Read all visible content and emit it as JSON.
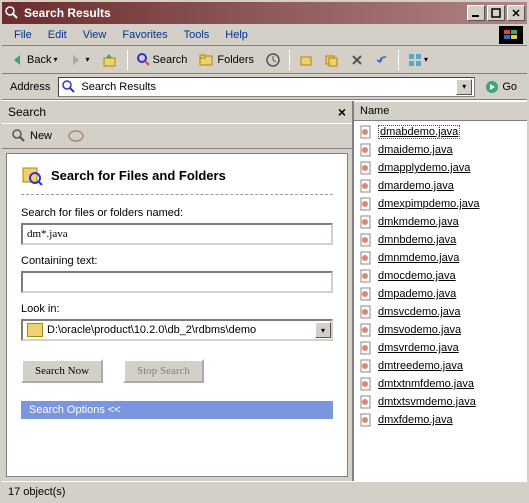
{
  "titlebar": {
    "title": "Search Results"
  },
  "menu": {
    "items": [
      "File",
      "Edit",
      "View",
      "Favorites",
      "Tools",
      "Help"
    ]
  },
  "toolbar": {
    "back": "Back",
    "search": "Search",
    "folders": "Folders"
  },
  "addressbar": {
    "label": "Address",
    "value": "Search Results",
    "go": "Go"
  },
  "searchpane": {
    "title": "Search",
    "new": "New",
    "heading": "Search for Files and Folders",
    "named_label": "Search for files or folders named:",
    "named_value": "dm*.java",
    "containing_label": "Containing text:",
    "containing_value": "",
    "lookin_label": "Look in:",
    "lookin_value": "D:\\oracle\\product\\10.2.0\\db_2\\rdbms\\demo",
    "search_now": "Search Now",
    "stop_search": "Stop Search",
    "options": "Search Options  <<"
  },
  "results": {
    "column": "Name",
    "files": [
      "dmabdemo.java",
      "dmaidemo.java",
      "dmapplydemo.java",
      "dmardemo.java",
      "dmexpimpdemo.java",
      "dmkmdemo.java",
      "dmnbdemo.java",
      "dmnmdemo.java",
      "dmocdemo.java",
      "dmpademo.java",
      "dmsvcdemo.java",
      "dmsvodemo.java",
      "dmsvrdemo.java",
      "dmtreedemo.java",
      "dmtxtnmfdemo.java",
      "dmtxtsvmdemo.java",
      "dmxfdemo.java"
    ]
  },
  "statusbar": {
    "text": "17 object(s)"
  }
}
